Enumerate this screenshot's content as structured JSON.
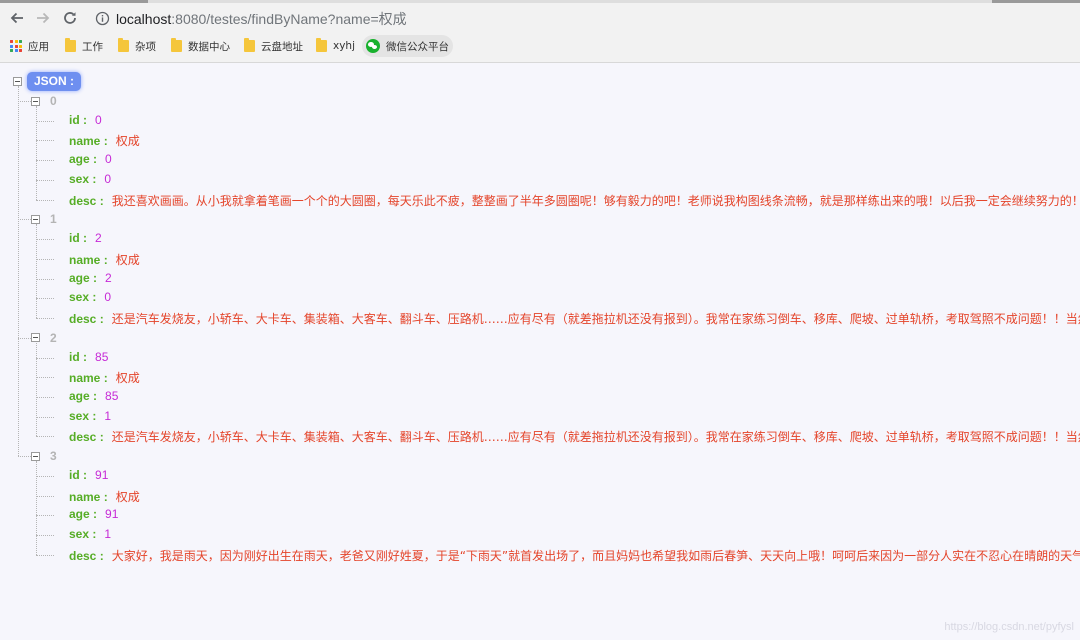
{
  "browser": {
    "url_host": "localhost",
    "url_rest": ":8080/testes/findByName?name=权成",
    "bookmarks": [
      "应用",
      "工作",
      "杂项",
      "数据中心",
      "云盘地址",
      "xyhj",
      "微信公众平台"
    ],
    "apps_colors": [
      "#e94235",
      "#fbbc04",
      "#34a853",
      "#4285f4",
      "#e94235",
      "#fbbc04",
      "#34a853",
      "#4285f4",
      "#e94235"
    ]
  },
  "viewer": {
    "root_label": "JSON :",
    "records": [
      {
        "index": "0",
        "id": "0",
        "name": "权成",
        "age": "0",
        "sex": "0",
        "desc": "我还喜欢画画。从小我就拿着笔画一个个的大圆圈，每天乐此不疲，整整画了半年多圆圈呢！够有毅力的吧！老师说我构图线条流畅，就是那样练出来的哦！以后我一定会继续努力的！可是我"
      },
      {
        "index": "1",
        "id": "2",
        "name": "权成",
        "age": "2",
        "sex": "0",
        "desc": "还是汽车发烧友，小轿车、大卡车、集装箱、大客车、翻斗车、压路机……应有尽有（就差拖拉机还没有报到）。我常在家练习倒车、移库、爬坡、过单轨桥，考取驾照不成问题！！当然我也"
      },
      {
        "index": "2",
        "id": "85",
        "name": "权成",
        "age": "85",
        "sex": "1",
        "desc": "还是汽车发烧友，小轿车、大卡车、集装箱、大客车、翻斗车、压路机……应有尽有（就差拖拉机还没有报到）。我常在家练习倒车、移库、爬坡、过单轨桥，考取驾照不成问题！！当然我也"
      },
      {
        "index": "3",
        "id": "91",
        "name": "权成",
        "age": "91",
        "sex": "1",
        "desc": "大家好，我是雨天，因为刚好出生在雨天，老爸又刚好姓夏，于是“下雨天”就首发出场了，而且妈妈也希望我如雨后春笋、天天向上哦！呵呵后来因为一部分人实在不忍心在晴朗的天气里叫我"
      }
    ]
  },
  "watermark": "https://blog.csdn.net/pyfysl"
}
